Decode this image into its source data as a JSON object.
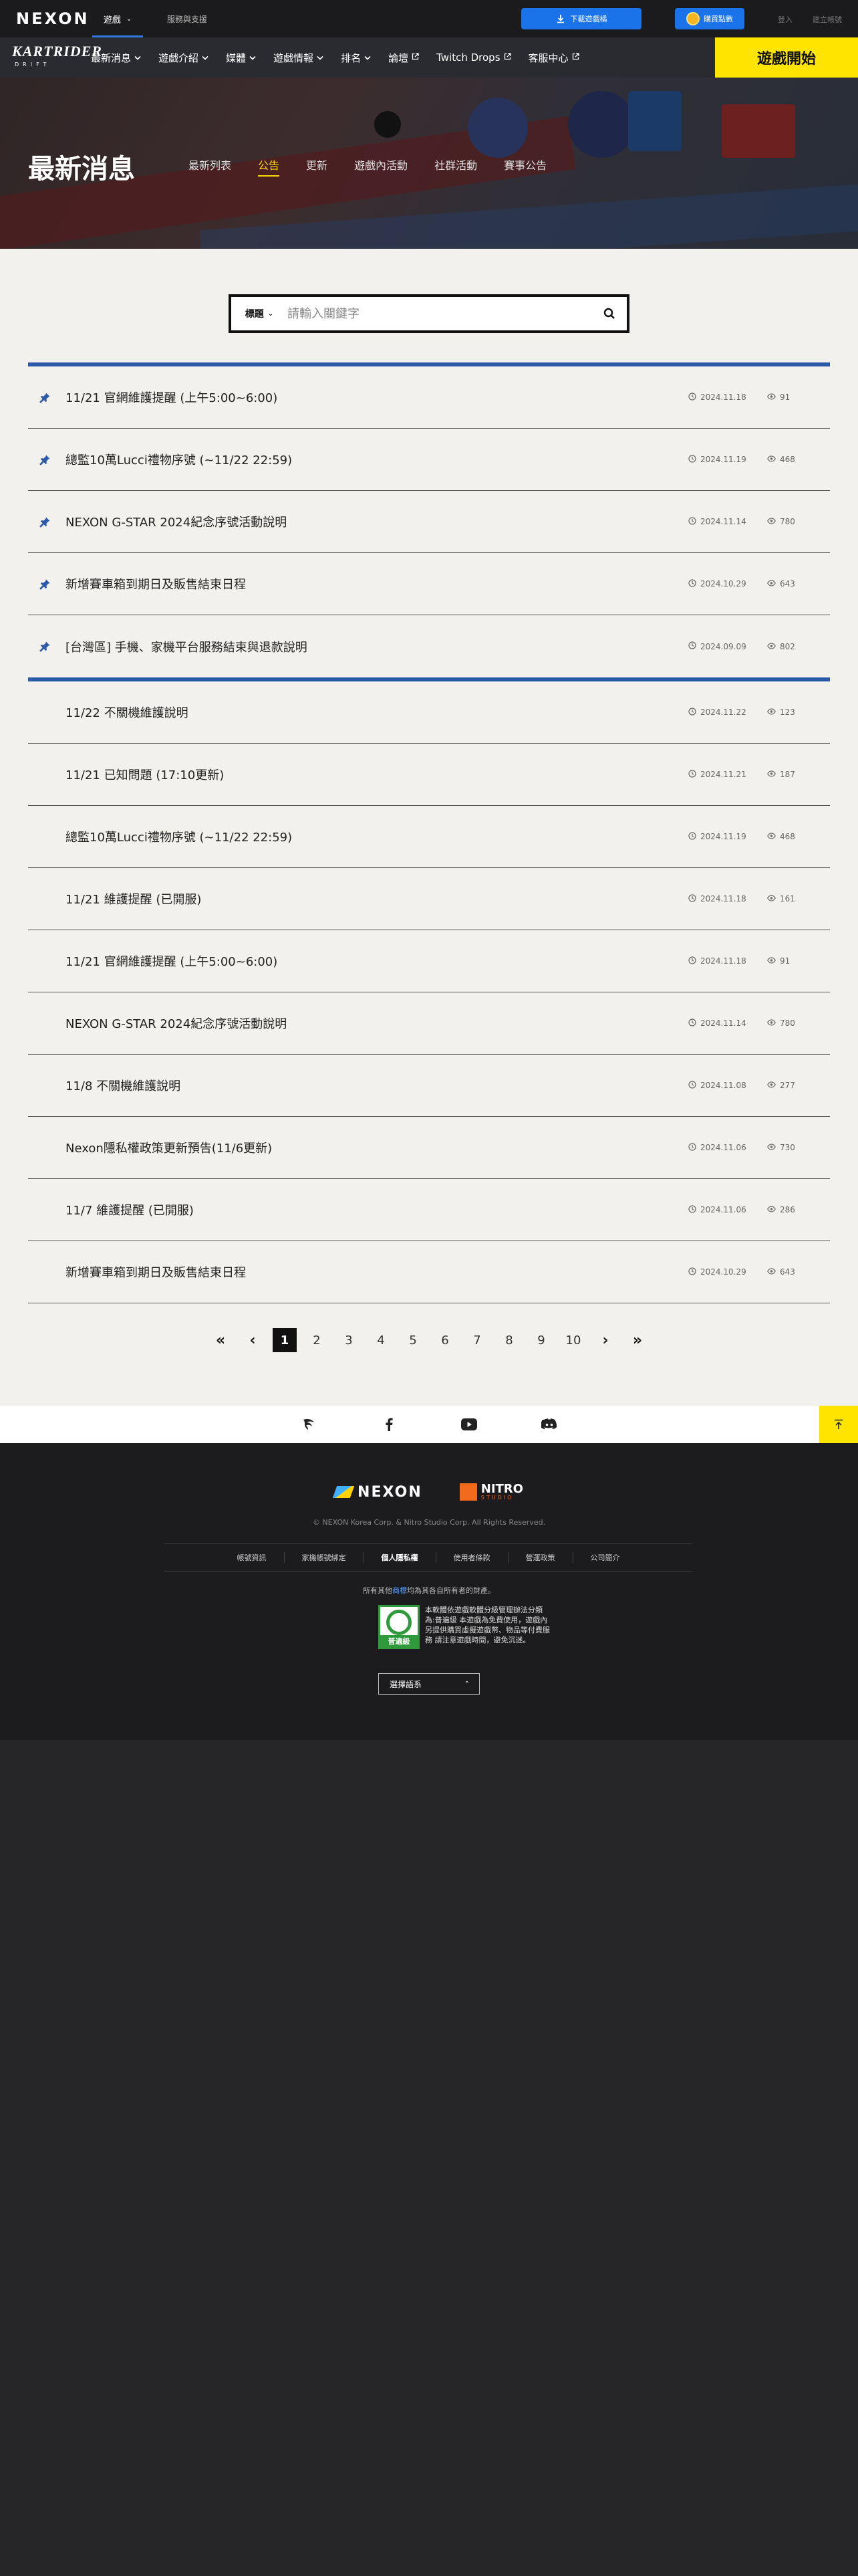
{
  "topbar": {
    "logo": "NEXON",
    "games_label": "遊戲",
    "support_label": "服務與支援",
    "download_label": "下載遊戲橘",
    "coin_label": "購買點數",
    "login_label": "登入",
    "register_label": "建立帳號"
  },
  "gamenav": {
    "logo": "KARTRIDER",
    "logo_sub": "DRIFT",
    "items": [
      {
        "label": "最新消息",
        "icon": "chevron-down-icon"
      },
      {
        "label": "遊戲介紹",
        "icon": "chevron-down-icon"
      },
      {
        "label": "媒體",
        "icon": "chevron-down-icon"
      },
      {
        "label": "遊戲情報",
        "icon": "chevron-down-icon"
      },
      {
        "label": "排名",
        "icon": "chevron-down-icon"
      },
      {
        "label": "論壇",
        "icon": "external-link-icon"
      },
      {
        "label": "Twitch Drops",
        "icon": "external-link-icon"
      },
      {
        "label": "客服中心",
        "icon": "external-link-icon"
      }
    ],
    "start_label": "遊戲開始"
  },
  "hero": {
    "title": "最新消息",
    "tabs": [
      "最新列表",
      "公告",
      "更新",
      "遊戲內活動",
      "社群活動",
      "賽事公告"
    ],
    "active_tab": 1
  },
  "search": {
    "select_label": "標題",
    "placeholder": "請輸入關鍵字"
  },
  "pinned": [
    {
      "title": "11/21 官網維護提醒 (上午5:00~6:00)",
      "date": "2024.11.18",
      "views": "91"
    },
    {
      "title": "總監10萬Lucci禮物序號 (~11/22 22:59)",
      "date": "2024.11.19",
      "views": "468"
    },
    {
      "title": "NEXON G-STAR 2024紀念序號活動說明",
      "date": "2024.11.14",
      "views": "780"
    },
    {
      "title": "新增賽車箱到期日及販售結束日程",
      "date": "2024.10.29",
      "views": "643"
    },
    {
      "title": "[台灣區] 手機、家機平台服務結束與退款說明",
      "date": "2024.09.09",
      "views": "802"
    }
  ],
  "posts": [
    {
      "title": "11/22 不關機維護說明",
      "date": "2024.11.22",
      "views": "123"
    },
    {
      "title": "11/21 已知問題 (17:10更新)",
      "date": "2024.11.21",
      "views": "187"
    },
    {
      "title": "總監10萬Lucci禮物序號 (~11/22 22:59)",
      "date": "2024.11.19",
      "views": "468"
    },
    {
      "title": "11/21 維護提醒 (已開服)",
      "date": "2024.11.18",
      "views": "161"
    },
    {
      "title": "11/21 官網維護提醒 (上午5:00~6:00)",
      "date": "2024.11.18",
      "views": "91"
    },
    {
      "title": "NEXON G-STAR 2024紀念序號活動說明",
      "date": "2024.11.14",
      "views": "780"
    },
    {
      "title": "11/8 不關機維護說明",
      "date": "2024.11.08",
      "views": "277"
    },
    {
      "title": "Nexon隱私權政策更新預告(11/6更新)",
      "date": "2024.11.06",
      "views": "730"
    },
    {
      "title": "11/7 維護提醒 (已開服)",
      "date": "2024.11.06",
      "views": "286"
    },
    {
      "title": "新增賽車箱到期日及販售結束日程",
      "date": "2024.10.29",
      "views": "643"
    }
  ],
  "pager": {
    "first": "«",
    "prev": "‹",
    "pages": [
      "1",
      "2",
      "3",
      "4",
      "5",
      "6",
      "7",
      "8",
      "9",
      "10"
    ],
    "active": 0,
    "next": "›",
    "last": "»"
  },
  "footer": {
    "nexon_logo": "NEXON",
    "nitro_logo": "NITRO",
    "nitro_sub": "STUDIO",
    "copyright": "© NEXON Korea Corp. & Nitro Studio Corp. All Rights Reserved.",
    "links": [
      "帳號資訊",
      "家機帳號綁定",
      "個人隱私權",
      "使用者條款",
      "營運政策",
      "公司簡介"
    ],
    "strong_link": 2,
    "trademark_pre": "所有其他",
    "trademark_hl": "商標",
    "trademark_post": "均為其各自所有者的財產。",
    "rating_label": "普遍級",
    "rating_text": "本軟體依遊戲軟體分級管理辦法分類為:普遍級 本遊戲為免費使用，遊戲內另提供購買虛擬遊戲幣、物品等付費服務 請注意遊戲時間，避免沉迷。",
    "language_label": "選擇語系"
  }
}
